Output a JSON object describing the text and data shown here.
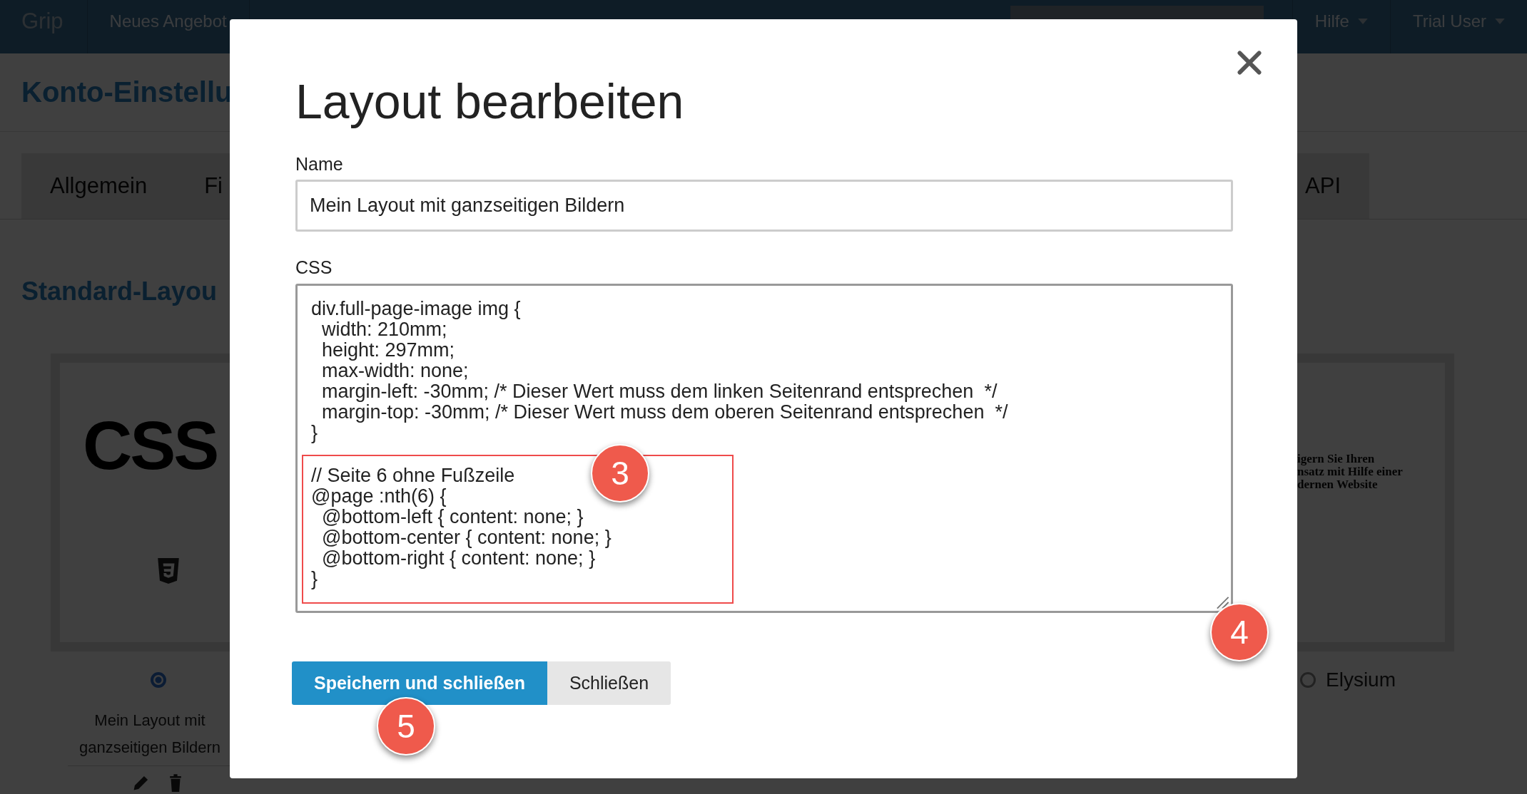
{
  "top_nav": {
    "logo": "Grip",
    "items": [
      {
        "label": "Neues Angebot",
        "dropdown": false
      }
    ],
    "right_items": [
      {
        "label": "Hilfe",
        "dropdown": true
      },
      {
        "label": "Trial User",
        "dropdown": true
      }
    ]
  },
  "page": {
    "title": "Konto-Einstellu",
    "tabs_left": [
      "Allgemein",
      "Fi"
    ],
    "tabs_right": [
      "API"
    ],
    "section_title": "Standard-Layou",
    "layouts": [
      {
        "kind": "css",
        "preview_text": "CSS",
        "name": "Mein Layout mit ganzseitigen Bildern",
        "selected": true
      },
      {
        "kind": "document",
        "preview_lines": [
          "igern Sie Ihren",
          "nsatz mit Hilfe einer",
          "dernen Website"
        ],
        "name": "Elysium",
        "selected": false
      }
    ]
  },
  "modal": {
    "title": "Layout bearbeiten",
    "name_label": "Name",
    "name_value": "Mein Layout mit ganzseitigen Bildern",
    "css_label": "CSS",
    "css_lines": [
      "div.full-page-image img {",
      "  width: 210mm;",
      "  height: 297mm;",
      "  max-width: none;",
      "  margin-left: -30mm; /* Dieser Wert muss dem linken Seitenrand entsprechen  */",
      "  margin-top: -30mm; /* Dieser Wert muss dem oberen Seitenrand entsprechen  */",
      "}"
    ],
    "css_field_callout": "4",
    "highlight": {
      "callout": "3",
      "lines": [
        "// Seite 6 ohne Fußzeile",
        "@page :nth(6) {",
        "  @bottom-left { content: none; }",
        "  @bottom-center { content: none; }",
        "  @bottom-right { content: none; }",
        "}"
      ]
    },
    "buttons": [
      {
        "label": "Speichern und schließen",
        "kind": "primary",
        "callout": "5"
      },
      {
        "label": "Schließen",
        "kind": "secondary"
      }
    ]
  }
}
